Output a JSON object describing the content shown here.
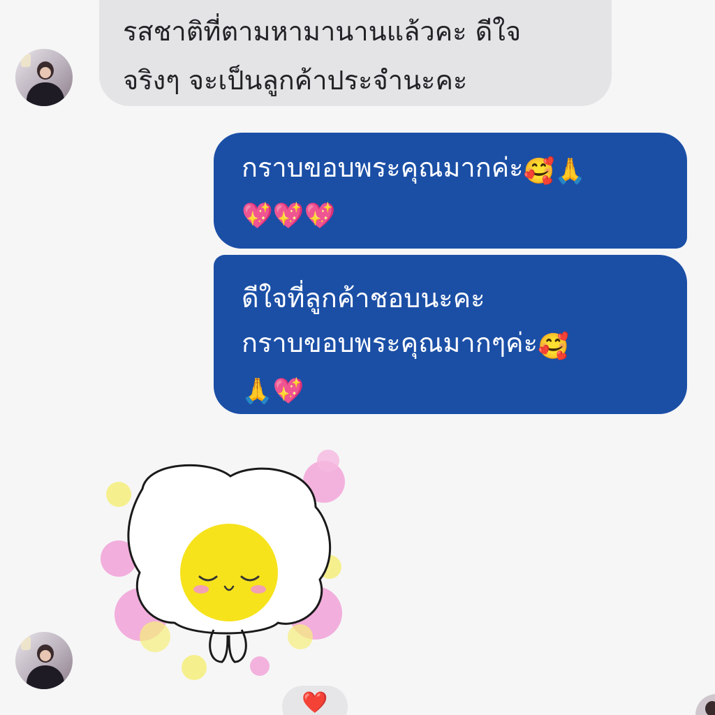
{
  "messages": {
    "incoming_1": {
      "line1": "รสชาติที่ตามหามานานแล้วคะ ดีใจ",
      "line2": "จริงๆ จะเป็นลูกค้าประจำนะคะ"
    },
    "outgoing_1": {
      "line1": "กราบขอบพระคุณมากค่ะ",
      "line1_emojis": "🥰🙏",
      "line2_emojis": "💖💖💖"
    },
    "outgoing_2": {
      "line1": "ดีใจที่ลูกค้าชอบนะคะ",
      "line2": "กราบขอบพระคุณมากๆค่ะ",
      "line2_emojis": "🥰",
      "line3_emojis": "🙏💖"
    }
  },
  "reaction": {
    "emoji": "❤️"
  },
  "icons": {
    "avatar": "user-avatar",
    "sticker": "praying-sun-sticker",
    "reaction": "heart-reaction-icon"
  },
  "colors": {
    "background": "#f6f6f7",
    "incoming_bubble": "#e4e4e6",
    "outgoing_bubble": "#1b4fa6",
    "outgoing_text": "#ffffff",
    "incoming_text": "#222226"
  }
}
